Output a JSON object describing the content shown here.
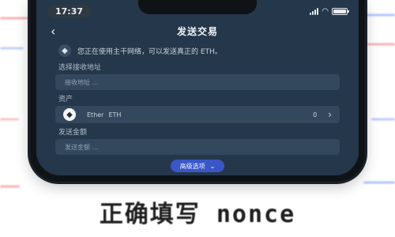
{
  "status_bar": {
    "time": "17:37"
  },
  "header": {
    "title": "发送交易",
    "back_icon": "chevron-left-icon"
  },
  "warning": {
    "icon": "ethereum-icon",
    "text": "您正在使用主干网络，可以发送真正的 ETH。"
  },
  "recipient": {
    "label": "选择接收地址",
    "placeholder": "接收地址 ..."
  },
  "asset": {
    "label": "资产",
    "name": "Ether",
    "symbol": "ETH",
    "balance": "0"
  },
  "amount": {
    "label": "发送金额",
    "placeholder": "发送金额 ..."
  },
  "advanced_button": {
    "label": "高级选项"
  },
  "banner": {
    "text": "正确填写 nonce"
  },
  "colors": {
    "screen_bg": "#25374a",
    "field_bg": "#33485d",
    "accent": "#3a57c7"
  }
}
